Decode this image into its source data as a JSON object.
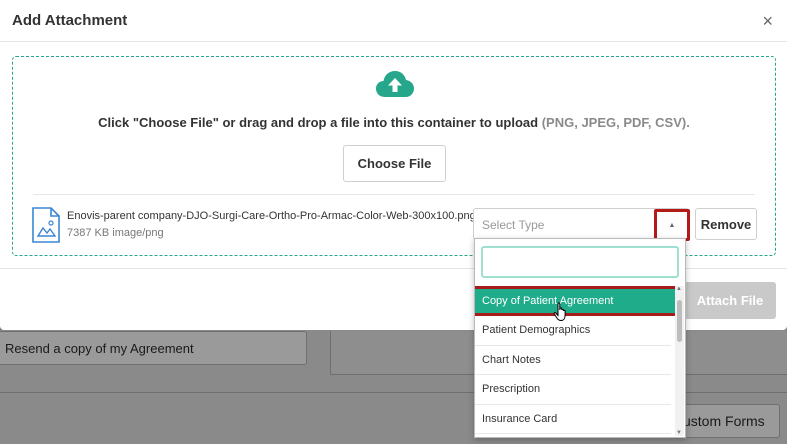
{
  "background": {
    "resend_label": "Resend a copy of my Agreement",
    "custom_forms_label": "ustom Forms"
  },
  "modal": {
    "title": "Add Attachment",
    "close_icon": "×",
    "upload_icon": "cloud-upload-icon",
    "instruction": "Click \"Choose File\" or drag and drop a file into this container to upload",
    "formats": "(PNG, JPEG, PDF, CSV).",
    "choose_file_label": "Choose File",
    "file": {
      "icon": "image-file-icon",
      "name": "Enovis-parent company-DJO-Surgi-Care-Ortho-Pro-Armac-Color-Web-300x100.png",
      "meta": "7387 KB image/png"
    },
    "type_select": {
      "placeholder": "Select Type",
      "search_value": ""
    },
    "remove_label": "Remove",
    "attach_label": "Attach File"
  },
  "dropdown": {
    "options": [
      "Copy of Patient Agreement",
      "Patient Demographics",
      "Chart Notes",
      "Prescription",
      "Insurance Card"
    ],
    "highlighted_index": 0
  },
  "colors": {
    "accent": "#1fac8b",
    "highlight_border": "#a61b1b",
    "disabled_button": "#c9c9c9"
  }
}
